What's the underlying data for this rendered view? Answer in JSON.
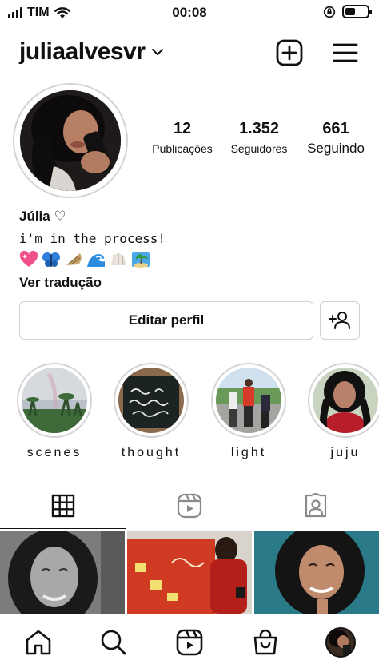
{
  "status_bar": {
    "carrier": "TIM",
    "time": "00:08"
  },
  "header": {
    "username": "juliaalvesvr"
  },
  "profile": {
    "stats": [
      {
        "value": "12",
        "label": "Publicações"
      },
      {
        "value": "1.352",
        "label": "Seguidores"
      },
      {
        "value": "661",
        "label": "Seguindo"
      }
    ],
    "name": "Júlia ♡",
    "bio": "i'm in the process!",
    "translate_link": "Ver tradução"
  },
  "actions": {
    "edit_label": "Editar perfil"
  },
  "highlights": [
    {
      "label": "scenes"
    },
    {
      "label": "thought"
    },
    {
      "label": "light"
    },
    {
      "label": "juju"
    }
  ],
  "tabs": [
    "grid",
    "reels",
    "tagged"
  ],
  "colors": {
    "text": "#111111",
    "border": "#d0d0d0",
    "ring": "#d4d4d4"
  }
}
